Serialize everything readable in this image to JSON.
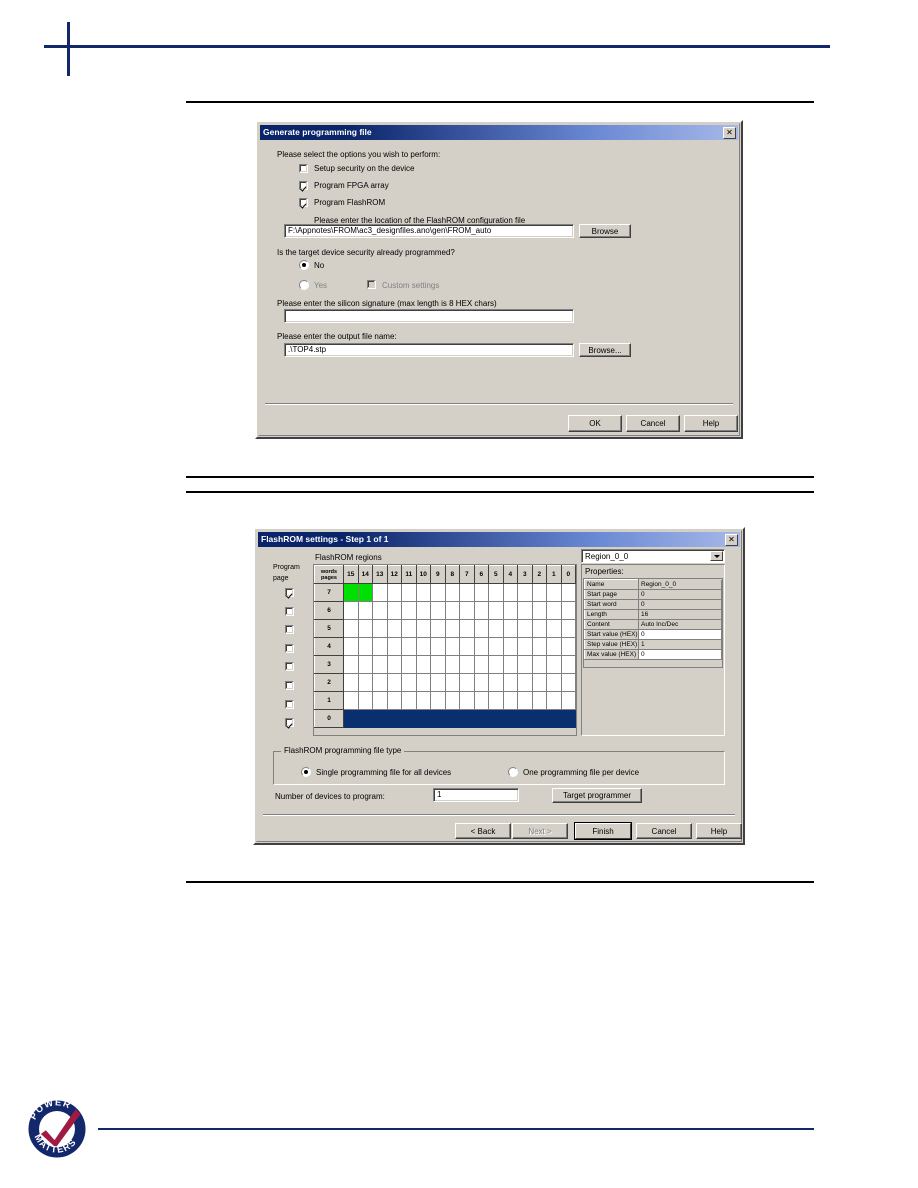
{
  "page": {
    "header_decoration": "navy-cross-rule",
    "footer_logo_text_top": "POWER",
    "footer_logo_text_bottom": "MATTERS"
  },
  "dialog_generate": {
    "title": "Generate programming file",
    "close_label": "✕",
    "instruction": "Please select the options you wish to perform:",
    "options": [
      {
        "label": "Setup security on the device",
        "checked": false
      },
      {
        "label": "Program FPGA array",
        "checked": true
      },
      {
        "label": "Program FlashROM",
        "checked": true
      }
    ],
    "flashrom_config_label": "Please enter the location of the FlashROM configuration file",
    "flashrom_config_value": "F:\\Appnotes\\FROM\\ac3_designfiles.ano\\gen\\FROM_auto",
    "browse_label": "Browse",
    "security_question": "Is the target device security already programmed?",
    "security_no_label": "No",
    "security_yes_label": "Yes",
    "security_selected": "No",
    "custom_settings_label": "Custom settings",
    "custom_settings_checked": false,
    "custom_settings_disabled": true,
    "signature_label": "Please enter the silicon signature (max length is 8 HEX chars)",
    "signature_value": "",
    "output_file_label": "Please enter the output file name:",
    "output_file_value": ".\\TOP4.stp",
    "output_browse_label": "Browse...",
    "buttons": [
      {
        "label": "OK",
        "state": "normal"
      },
      {
        "label": "Cancel",
        "state": "normal"
      },
      {
        "label": "Help",
        "state": "normal"
      }
    ]
  },
  "dialog_flashrom": {
    "title": "FlashROM settings - Step 1 of 1",
    "close_label": "✕",
    "regions_label": "FlashROM regions",
    "region_combo_value": "Region_0_0",
    "properties_label": "Properties:",
    "program_page_label_line1": "Program",
    "program_page_label_line2": "page",
    "grid": {
      "corner_label_line1": "words",
      "corner_label_line2": "pages",
      "columns": [
        "15",
        "14",
        "13",
        "12",
        "11",
        "10",
        "9",
        "8",
        "7",
        "6",
        "5",
        "4",
        "3",
        "2",
        "1",
        "0"
      ],
      "rows": [
        {
          "label": "7",
          "program": true,
          "cells": [
            "green",
            "green",
            "",
            "",
            "",
            "",
            "",
            "",
            "",
            "",
            "",
            "",
            "",
            "",
            "",
            ""
          ]
        },
        {
          "label": "6",
          "program": false,
          "cells": [
            "",
            "",
            "",
            "",
            "",
            "",
            "",
            "",
            "",
            "",
            "",
            "",
            "",
            "",
            "",
            ""
          ]
        },
        {
          "label": "5",
          "program": false,
          "cells": [
            "",
            "",
            "",
            "",
            "",
            "",
            "",
            "",
            "",
            "",
            "",
            "",
            "",
            "",
            "",
            ""
          ]
        },
        {
          "label": "4",
          "program": false,
          "cells": [
            "",
            "",
            "",
            "",
            "",
            "",
            "",
            "",
            "",
            "",
            "",
            "",
            "",
            "",
            "",
            ""
          ]
        },
        {
          "label": "3",
          "program": false,
          "cells": [
            "",
            "",
            "",
            "",
            "",
            "",
            "",
            "",
            "",
            "",
            "",
            "",
            "",
            "",
            "",
            ""
          ]
        },
        {
          "label": "2",
          "program": false,
          "cells": [
            "",
            "",
            "",
            "",
            "",
            "",
            "",
            "",
            "",
            "",
            "",
            "",
            "",
            "",
            "",
            ""
          ]
        },
        {
          "label": "1",
          "program": false,
          "cells": [
            "",
            "",
            "",
            "",
            "",
            "",
            "",
            "",
            "",
            "",
            "",
            "",
            "",
            "",
            "",
            ""
          ]
        },
        {
          "label": "0",
          "program": true,
          "cells": [
            "selected",
            "selected",
            "selected",
            "selected",
            "selected",
            "selected",
            "selected",
            "selected",
            "selected",
            "selected",
            "selected",
            "selected",
            "selected",
            "selected",
            "selected",
            "selected"
          ]
        }
      ]
    },
    "properties": [
      {
        "key": "Name",
        "value": "Region_0_0",
        "editable": false
      },
      {
        "key": "Start page",
        "value": "0",
        "editable": false
      },
      {
        "key": "Start word",
        "value": "0",
        "editable": false
      },
      {
        "key": "Length",
        "value": "16",
        "editable": false
      },
      {
        "key": "Content",
        "value": "Auto Inc/Dec",
        "editable": false
      },
      {
        "key": "Start value (HEX)",
        "value": "0",
        "editable": true
      },
      {
        "key": "Step value (HEX)",
        "value": "1",
        "editable": false
      },
      {
        "key": "Max value (HEX)",
        "value": "0",
        "editable": true
      }
    ],
    "filetype_group_label": "FlashROM programming file type",
    "filetype_options": [
      {
        "label": "Single programming file for all devices",
        "selected": true
      },
      {
        "label": "One programming file per device",
        "selected": false
      }
    ],
    "num_devices_label": "Number of devices to program:",
    "num_devices_value": "1",
    "target_programmer_label": "Target programmer",
    "buttons": [
      {
        "label": "< Back",
        "state": "normal"
      },
      {
        "label": "Next >",
        "state": "disabled"
      },
      {
        "label": "Finish",
        "state": "default"
      },
      {
        "label": "Cancel",
        "state": "normal"
      },
      {
        "label": "Help",
        "state": "normal"
      }
    ]
  },
  "colors": {
    "titlebar_navy": "#0a246a",
    "dialog_face": "#d4d0c8",
    "grid_green": "#00e000",
    "grid_selected": "#0a2f6e",
    "brand_navy": "#13276b",
    "brand_red": "#a01a42"
  }
}
